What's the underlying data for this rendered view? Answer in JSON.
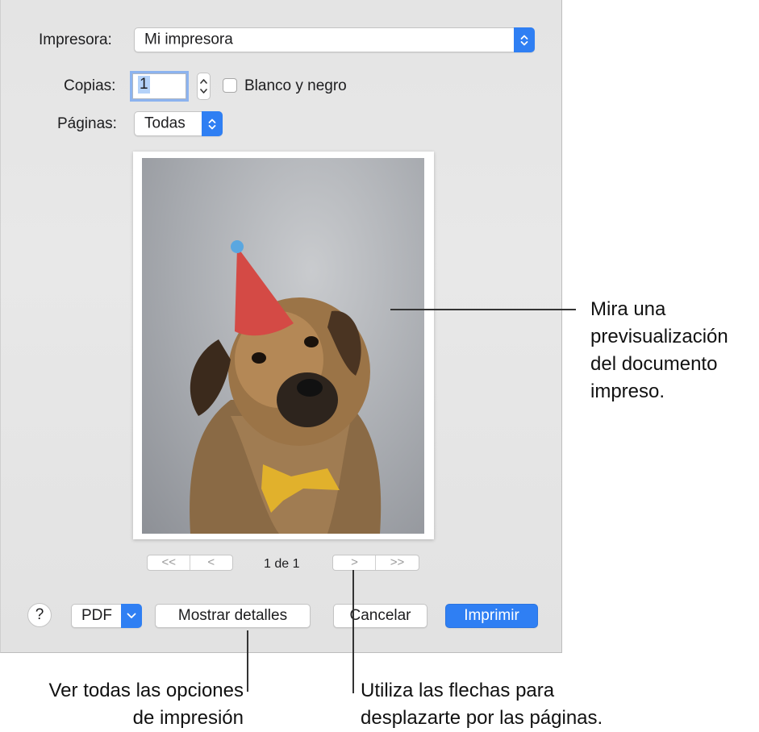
{
  "printer": {
    "label": "Impresora:",
    "value": "Mi impresora"
  },
  "copies": {
    "label": "Copias:",
    "value": "1",
    "bw_label": "Blanco y negro"
  },
  "pages": {
    "label": "Páginas:",
    "value": "Todas"
  },
  "navigation": {
    "first": "<<",
    "prev": "<",
    "page_info": "1 de 1",
    "next": ">",
    "last": ">>"
  },
  "footer": {
    "help": "?",
    "pdf": "PDF",
    "details": "Mostrar detalles",
    "cancel": "Cancelar",
    "print": "Imprimir"
  },
  "callouts": {
    "preview": [
      "Mira una",
      "previsualización",
      "del documento",
      "impreso."
    ],
    "details": [
      "Ver todas las opciones",
      "de impresión"
    ],
    "arrows": [
      "Utiliza las flechas para",
      "desplazarte por las páginas."
    ]
  },
  "colors": {
    "accent": "#2f7ff3",
    "focus_ring": "#8cb3ef",
    "dialog_bg": "#e5e5e5"
  }
}
